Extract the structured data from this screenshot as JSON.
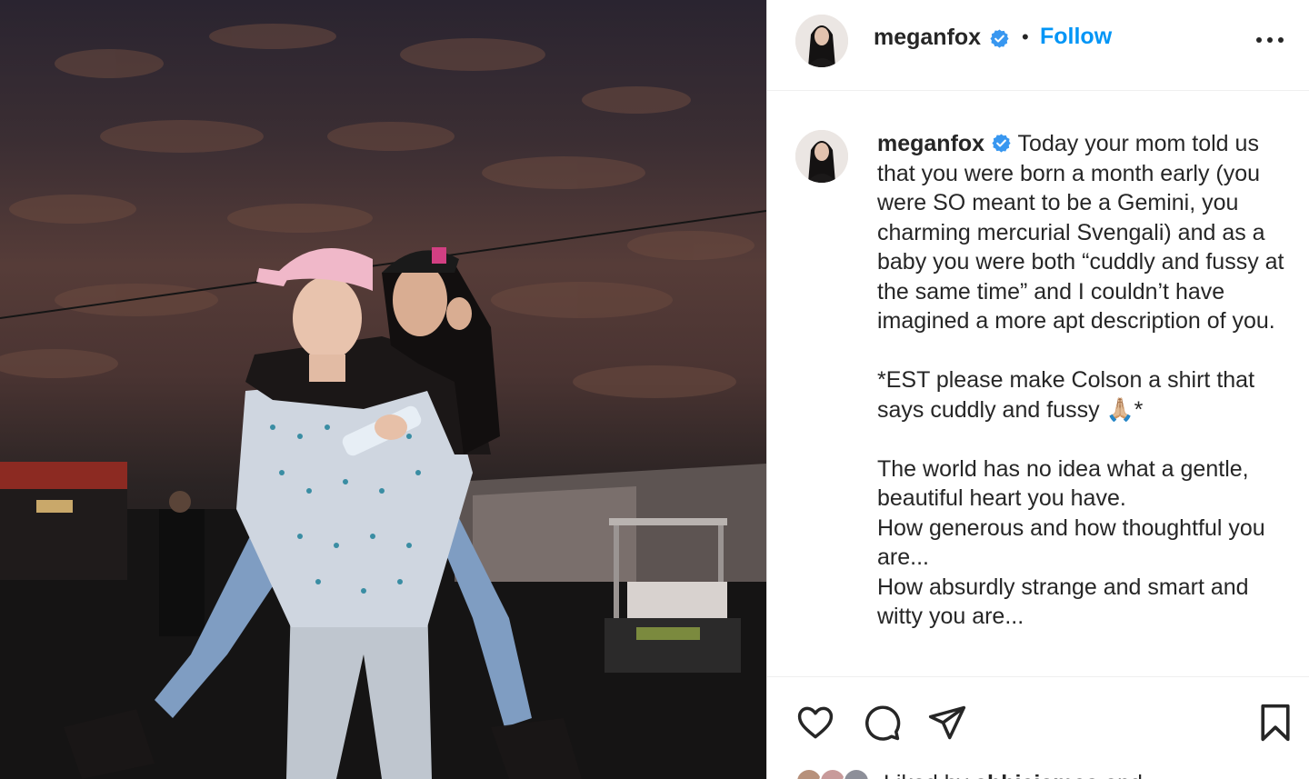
{
  "post": {
    "username": "meganfox",
    "follow_label": "Follow",
    "separator": "•"
  },
  "caption": {
    "username": "meganfox",
    "paragraphs": [
      "Today your mom told us that you were born a month early (you were SO meant to be a Gemini, you charming mercurial Svengali) and as a baby you were both “cuddly and fussy at the same time” and I couldn’t have imagined a more apt description of you.",
      "*EST please make Colson a shirt that says cuddly and fussy 🙏🏼*",
      "The world has no idea what a gentle, beautiful heart you have.",
      "How generous and how thoughtful you are...",
      "How absurdly strange and smart and witty you are..."
    ]
  },
  "likes": {
    "prefix": "Liked by",
    "user": "abbiejames",
    "suffix": "and"
  },
  "colors": {
    "accent": "#0095f6",
    "verified": "#3897f0",
    "text": "#262626"
  },
  "icons": [
    "verified-badge-icon",
    "more-options-icon",
    "heart-icon",
    "comment-icon",
    "share-icon",
    "bookmark-icon"
  ]
}
